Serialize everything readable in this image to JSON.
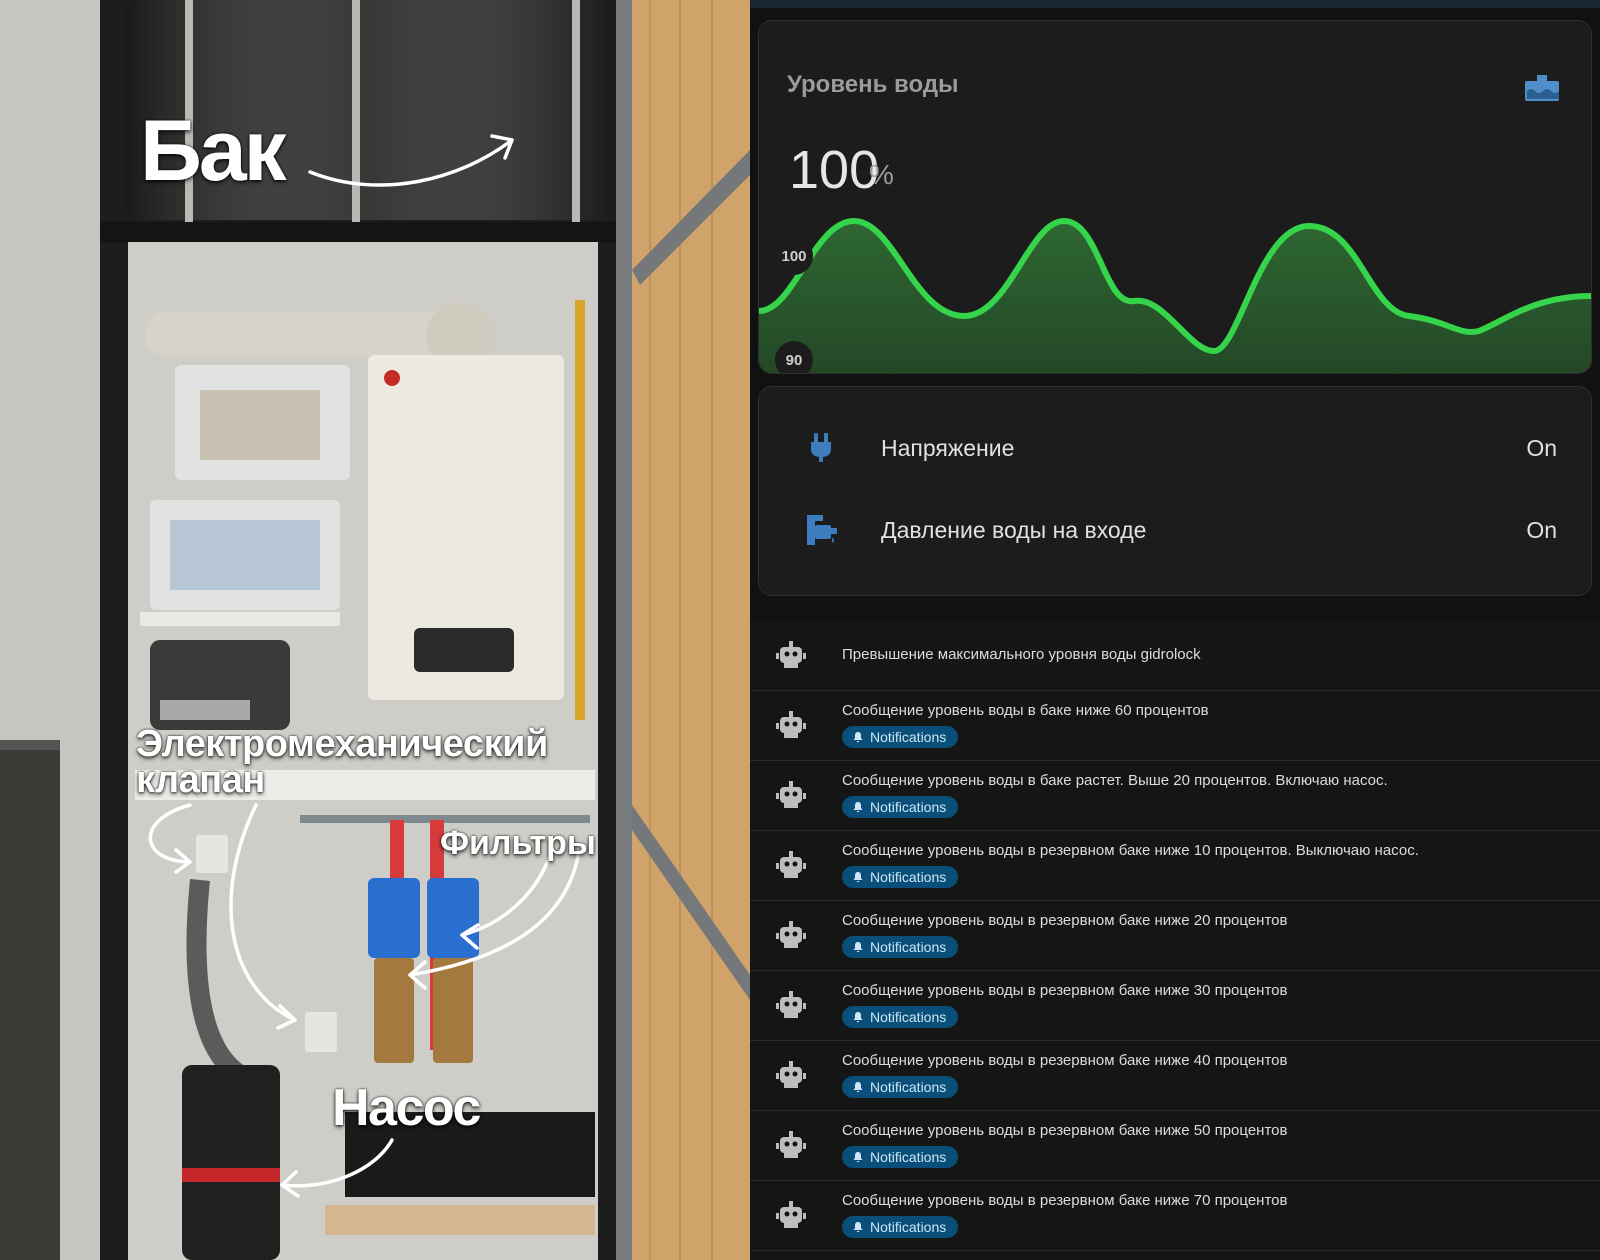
{
  "photo": {
    "labels": {
      "tank": "Бак",
      "valve_line1": "Электромеханический",
      "valve_line2": "клапан",
      "filters": "Фильтры",
      "pump": "Насос"
    }
  },
  "water_level": {
    "name": "Уровень воды",
    "value": "100",
    "unit": "%",
    "icon": "water-tank-icon",
    "y_ticks": [
      "100",
      "90"
    ],
    "line_color": "#35d44a"
  },
  "sensors": [
    {
      "label": "Напряжение",
      "state": "On",
      "icon": "power-plug-icon",
      "icon_color": "#3e7dbd"
    },
    {
      "label": "Давление воды на входе",
      "state": "On",
      "icon": "water-pump-icon",
      "icon_color": "#3e7dbd"
    }
  ],
  "automations": [
    {
      "title": "Превышение максимального уровня воды gidrolock",
      "tag": ""
    },
    {
      "title": "Сообщение уровень воды в баке ниже 60 процентов",
      "tag": "Notifications"
    },
    {
      "title": "Сообщение уровень воды в баке растет. Выше 20 процентов. Включаю насос.",
      "tag": "Notifications"
    },
    {
      "title": "Сообщение уровень воды в резервном баке ниже 10 процентов. Выключаю насос.",
      "tag": "Notifications"
    },
    {
      "title": "Сообщение уровень воды в резервном баке ниже 20 процентов",
      "tag": "Notifications"
    },
    {
      "title": "Сообщение уровень воды в резервном баке ниже 30 процентов",
      "tag": "Notifications"
    },
    {
      "title": "Сообщение уровень воды в резервном баке ниже 40 процентов",
      "tag": "Notifications"
    },
    {
      "title": "Сообщение уровень воды в резервном баке ниже 50 процентов",
      "tag": "Notifications"
    },
    {
      "title": "Сообщение уровень воды в резервном баке ниже 70 процентов",
      "tag": "Notifications"
    }
  ]
}
